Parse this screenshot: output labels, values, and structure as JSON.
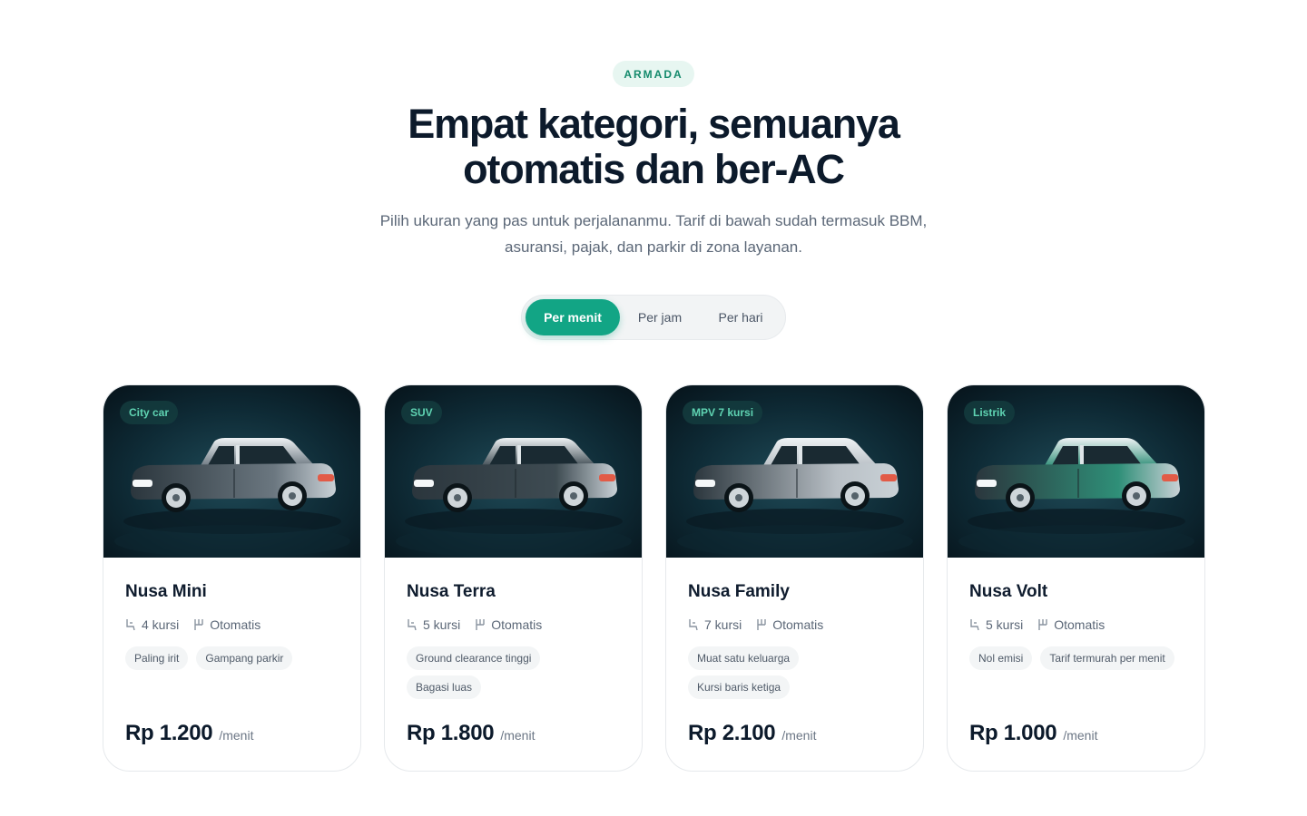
{
  "section": {
    "badge": "ARMADA",
    "title_line1": "Empat kategori, semuanya",
    "title_line2": "otomatis dan ber-AC",
    "subtitle_line1": "Pilih ukuran yang pas untuk perjalananmu. Tarif di bawah sudah termasuk BBM,",
    "subtitle_line2": "asuransi, pajak, dan parkir di zona layanan."
  },
  "pricing_toggle": {
    "options": [
      "Per menit",
      "Per jam",
      "Per hari"
    ],
    "selected": "Per menit"
  },
  "colors": {
    "accent": "#12a585",
    "dark_text": "#0c1a2b",
    "card_bg_dark": "#0b1d26"
  },
  "cards": [
    {
      "category": "City car",
      "name": "Nusa Mini",
      "seats": "4 kursi",
      "transmission": "Otomatis",
      "tags": [
        "Paling irit",
        "Gampang parkir"
      ],
      "price": "Rp 1.200",
      "unit": "/menit",
      "car_color": "#6b7780"
    },
    {
      "category": "SUV",
      "name": "Nusa Terra",
      "seats": "5 kursi",
      "transmission": "Otomatis",
      "tags": [
        "Ground clearance tinggi",
        "Bagasi luas"
      ],
      "price": "Rp 1.800",
      "unit": "/menit",
      "car_color": "#3e4b52"
    },
    {
      "category": "MPV 7 kursi",
      "name": "Nusa Family",
      "seats": "7 kursi",
      "transmission": "Otomatis",
      "tags": [
        "Muat satu keluarga",
        "Kursi baris ketiga"
      ],
      "price": "Rp 2.100",
      "unit": "/menit",
      "car_color": "#b9c0c6"
    },
    {
      "category": "Listrik",
      "name": "Nusa Volt",
      "seats": "5 kursi",
      "transmission": "Otomatis",
      "tags": [
        "Nol emisi",
        "Tarif termurah per menit"
      ],
      "price": "Rp 1.000",
      "unit": "/menit",
      "car_color": "#2f8f78"
    }
  ]
}
